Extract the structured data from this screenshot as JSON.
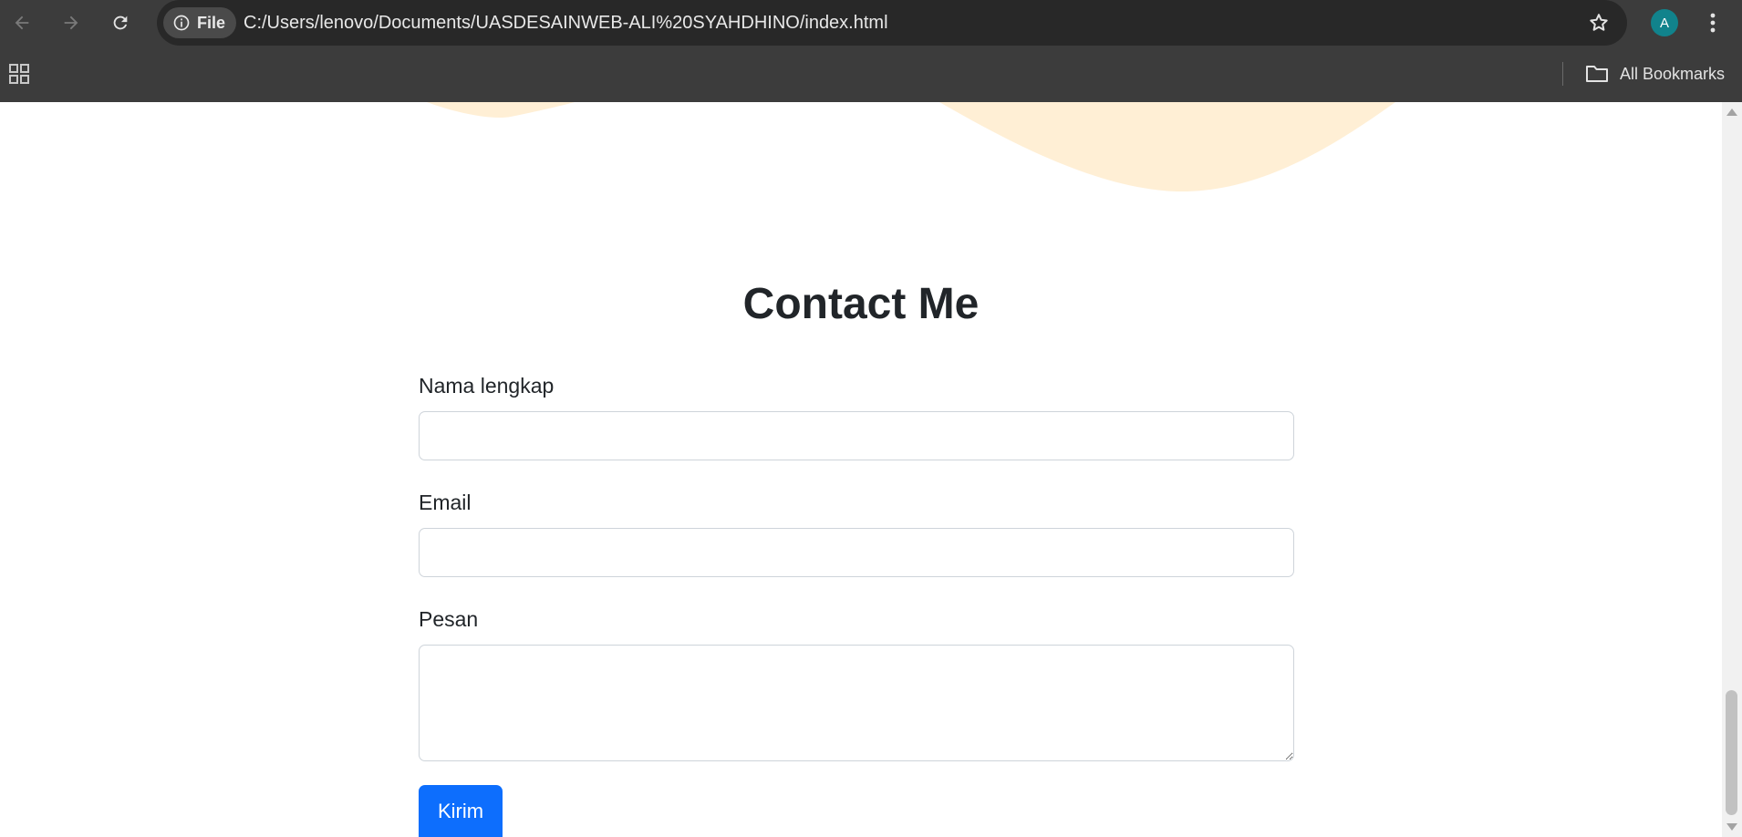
{
  "browser": {
    "site_chip_label": "File",
    "url": "C:/Users/lenovo/Documents/UASDESAINWEB-ALI%20SYAHDHINO/index.html",
    "profile_initial": "A",
    "bookmarks_label": "All Bookmarks",
    "icons": {
      "back": "arrow-left-icon",
      "forward": "arrow-right-icon",
      "reload": "reload-icon",
      "site_info": "info-circle-icon",
      "bookmark": "star-outline-icon",
      "menu": "three-dots-vertical-icon",
      "apps": "grid-icon",
      "folder": "folder-icon"
    }
  },
  "page": {
    "contact_title": "Contact Me",
    "form": {
      "name_label": "Nama lengkap",
      "name_value": "",
      "email_label": "Email",
      "email_value": "",
      "message_label": "Pesan",
      "message_value": "",
      "submit_label": "Kirim"
    }
  },
  "colors": {
    "toolbar_bg": "#3c3c3c",
    "omnibox_bg": "#282828",
    "wave_fill": "#ffefd5",
    "primary_button": "#0d6efd",
    "avatar_bg": "#11838c",
    "heading_text": "#212529"
  }
}
